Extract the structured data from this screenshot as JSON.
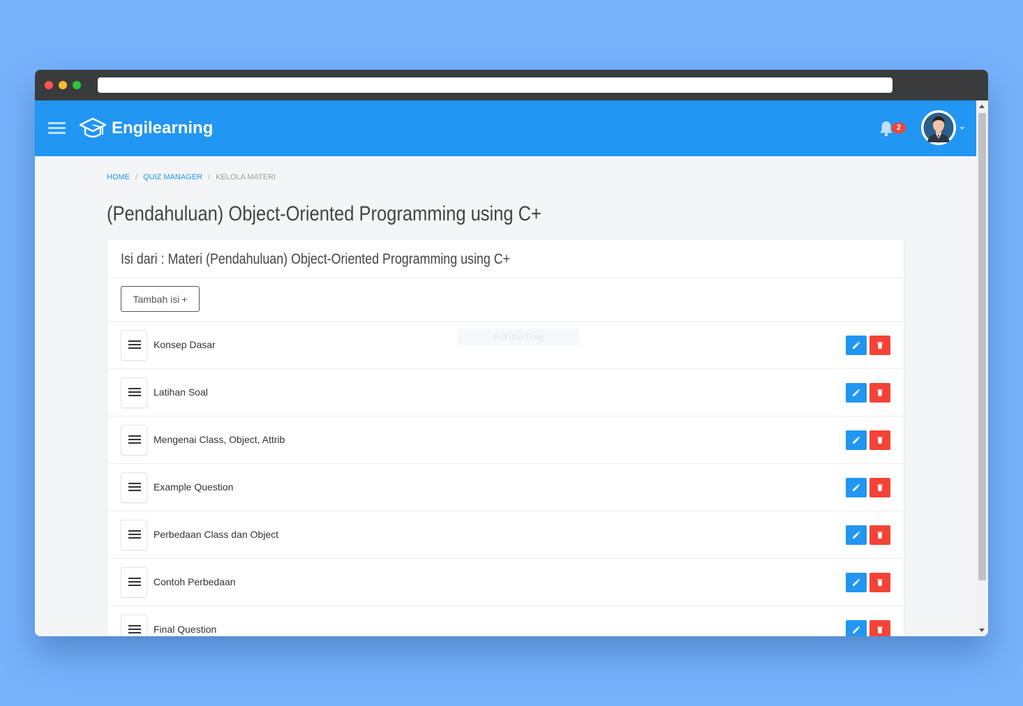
{
  "app": {
    "name": "Engilearning",
    "notification_count": "2"
  },
  "breadcrumb": {
    "home": "HOME",
    "sep": "/",
    "quiz_manager": "QUIZ MANAGER",
    "current": "KELOLA MATERI"
  },
  "page": {
    "title": "(Pendahuluan) Object-Oriented Programming using C+"
  },
  "card": {
    "title": "Isi dari : Materi (Pendahuluan) Object-Oriented Programming using C+",
    "add_button_label": "Tambah isi",
    "add_button_icon": "+",
    "drag_hint": "Pull dan Drag"
  },
  "items": [
    {
      "label": "Konsep Dasar"
    },
    {
      "label": "Latihan Soal"
    },
    {
      "label": "Mengenai Class, Object, Attrib"
    },
    {
      "label": "Example Question"
    },
    {
      "label": "Perbedaan Class dan Object"
    },
    {
      "label": "Contoh Perbedaan"
    },
    {
      "label": "Final Question"
    }
  ],
  "icons": {
    "menu": "hamburger-icon",
    "brand": "graduation-cap-icon",
    "notifications": "bell-icon",
    "drag": "drag-handle-icon",
    "edit": "pencil-icon",
    "delete": "trash-icon"
  },
  "colors": {
    "primary": "#2196f3",
    "danger": "#f44336",
    "background": "#f4f5f7",
    "desktop": "#77b2fb"
  }
}
